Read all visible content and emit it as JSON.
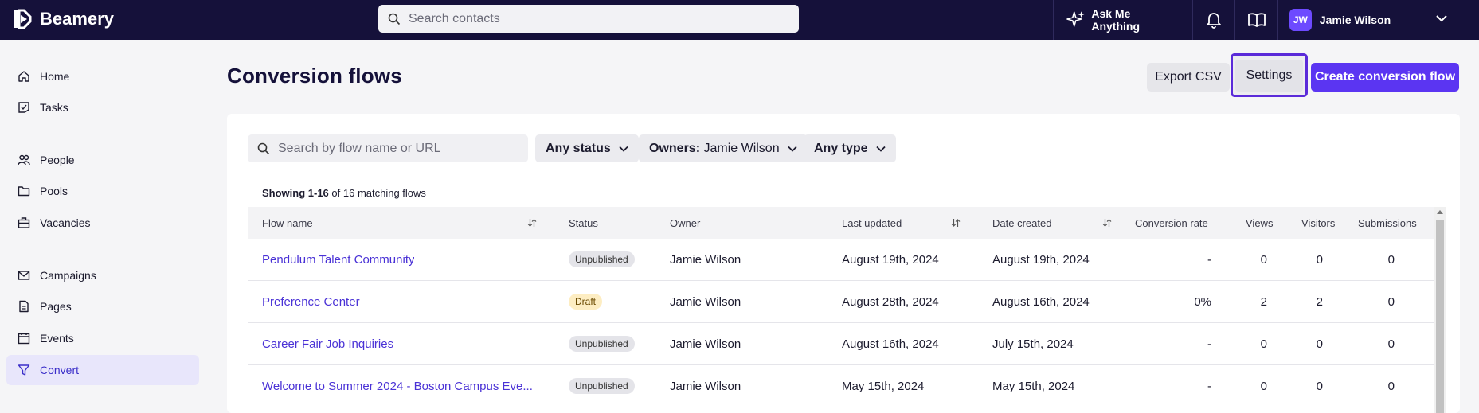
{
  "app": {
    "name": "Beamery"
  },
  "topbar": {
    "search_placeholder": "Search contacts",
    "ask_label": "Ask Me Anything",
    "user_initials": "JW",
    "user_name": "Jamie Wilson"
  },
  "sidebar": {
    "items": [
      {
        "label": "Home",
        "icon": "home-icon"
      },
      {
        "label": "Tasks",
        "icon": "tasks-icon"
      },
      {
        "label": "People",
        "icon": "people-icon"
      },
      {
        "label": "Pools",
        "icon": "folder-icon"
      },
      {
        "label": "Vacancies",
        "icon": "briefcase-icon"
      },
      {
        "label": "Campaigns",
        "icon": "mail-icon"
      },
      {
        "label": "Pages",
        "icon": "page-icon"
      },
      {
        "label": "Events",
        "icon": "calendar-icon"
      },
      {
        "label": "Convert",
        "icon": "filter-icon",
        "active": true
      }
    ]
  },
  "page": {
    "title": "Conversion flows",
    "export_label": "Export CSV",
    "settings_label": "Settings",
    "create_label": "Create conversion flow"
  },
  "filters": {
    "search_placeholder": "Search by flow name or URL",
    "status": "Any status",
    "owners_prefix": "Owners:",
    "owners_value": "Jamie Wilson",
    "type": "Any type"
  },
  "results": {
    "range": "Showing 1-16",
    "suffix": "of 16 matching flows"
  },
  "table": {
    "columns": {
      "flow_name": "Flow name",
      "status": "Status",
      "owner": "Owner",
      "last_updated": "Last updated",
      "date_created": "Date created",
      "conversion_rate": "Conversion rate",
      "views": "Views",
      "visitors": "Visitors",
      "submissions": "Submissions"
    },
    "rows": [
      {
        "name": "Pendulum Talent Community",
        "status": "Unpublished",
        "owner": "Jamie Wilson",
        "updated": "August 19th, 2024",
        "created": "August 19th, 2024",
        "rate": "-",
        "views": "0",
        "visitors": "0",
        "submissions": "0"
      },
      {
        "name": "Preference Center",
        "status": "Draft",
        "owner": "Jamie Wilson",
        "updated": "August 28th, 2024",
        "created": "August 16th, 2024",
        "rate": "0%",
        "views": "2",
        "visitors": "2",
        "submissions": "0"
      },
      {
        "name": "Career Fair Job Inquiries",
        "status": "Unpublished",
        "owner": "Jamie Wilson",
        "updated": "August 16th, 2024",
        "created": "July 15th, 2024",
        "rate": "-",
        "views": "0",
        "visitors": "0",
        "submissions": "0"
      },
      {
        "name": "Welcome to Summer 2024 - Boston Campus Eve...",
        "status": "Unpublished",
        "owner": "Jamie Wilson",
        "updated": "May 15th, 2024",
        "created": "May 15th, 2024",
        "rate": "-",
        "views": "0",
        "visitors": "0",
        "submissions": "0"
      }
    ]
  },
  "colors": {
    "topbar": "#15113a",
    "accent": "#5b35f2",
    "link": "#4a32d6",
    "active_nav_bg": "#e8e6fb"
  }
}
